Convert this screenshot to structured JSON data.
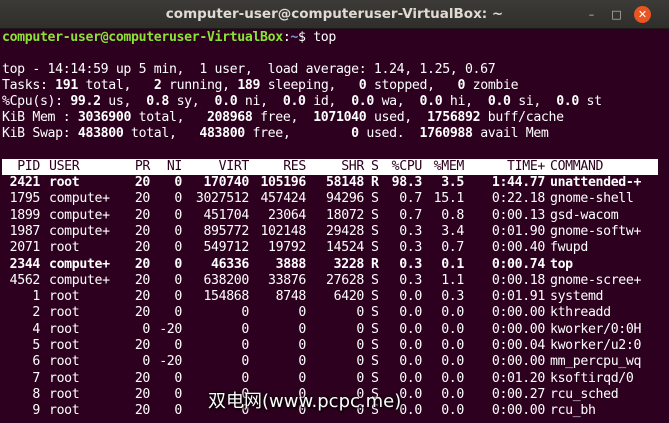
{
  "window": {
    "title": "computer-user@computeruser-VirtualBox: ~"
  },
  "prompt": {
    "user_host": "computer-user@computeruser-VirtualBox",
    "sep": ":",
    "path": "~",
    "symbol": "$ ",
    "command": "top"
  },
  "summary": {
    "line1": "top - 14:14:59 up 5 min,  1 user,  load average: 1.24, 1.25, 0.67",
    "tasks": {
      "label": "Tasks: ",
      "total": "191",
      "t1": " total,   ",
      "running": "2",
      "t2": " running, ",
      "sleeping": "189",
      "t3": " sleeping,   ",
      "stopped": "0",
      "t4": " stopped,   ",
      "zombie": "0",
      "t5": " zombie"
    },
    "cpu": {
      "label": "%Cpu(s): ",
      "us": "99.2",
      "t1": " us,  ",
      "sy": "0.8",
      "t2": " sy,  ",
      "ni": "0.0",
      "t3": " ni,  ",
      "id": "0.0",
      "t4": " id,  ",
      "wa": "0.0",
      "t5": " wa,  ",
      "hi": "0.0",
      "t6": " hi,  ",
      "si": "0.0",
      "t7": " si,  ",
      "st": "0.0",
      "t8": " st"
    },
    "mem": {
      "label": "KiB Mem : ",
      "total": "3036900",
      "t1": " total,   ",
      "free": "208968",
      "t2": " free,  ",
      "used": "1071040",
      "t3": " used,  ",
      "buff": "1756892",
      "t4": " buff/cache"
    },
    "swap": {
      "label": "KiB Swap: ",
      "total": "483800",
      "t1": " total,   ",
      "free": "483800",
      "t2": " free,        ",
      "used": "0",
      "t3": " used.  ",
      "avail": "1760988",
      "t4": " avail Mem"
    }
  },
  "columns": [
    "PID",
    "USER",
    "PR",
    "NI",
    "VIRT",
    "RES",
    "SHR",
    "S",
    "%CPU",
    "%MEM",
    "TIME+",
    "COMMAND"
  ],
  "processes": [
    {
      "pid": "2421",
      "user": "root",
      "pr": "20",
      "ni": "0",
      "virt": "170740",
      "res": "105196",
      "shr": "58148",
      "s": "R",
      "cpu": "98.3",
      "mem": "3.5",
      "time": "1:44.77",
      "command": "unattended-+",
      "bold": true
    },
    {
      "pid": "1795",
      "user": "compute+",
      "pr": "20",
      "ni": "0",
      "virt": "3027512",
      "res": "457424",
      "shr": "94296",
      "s": "S",
      "cpu": "0.7",
      "mem": "15.1",
      "time": "0:22.18",
      "command": "gnome-shell",
      "bold": false
    },
    {
      "pid": "1899",
      "user": "compute+",
      "pr": "20",
      "ni": "0",
      "virt": "451704",
      "res": "23064",
      "shr": "18072",
      "s": "S",
      "cpu": "0.7",
      "mem": "0.8",
      "time": "0:00.13",
      "command": "gsd-wacom",
      "bold": false
    },
    {
      "pid": "1987",
      "user": "compute+",
      "pr": "20",
      "ni": "0",
      "virt": "895772",
      "res": "102148",
      "shr": "29428",
      "s": "S",
      "cpu": "0.3",
      "mem": "3.4",
      "time": "0:01.90",
      "command": "gnome-softw+",
      "bold": false
    },
    {
      "pid": "2071",
      "user": "root",
      "pr": "20",
      "ni": "0",
      "virt": "549712",
      "res": "19792",
      "shr": "14524",
      "s": "S",
      "cpu": "0.3",
      "mem": "0.7",
      "time": "0:00.40",
      "command": "fwupd",
      "bold": false
    },
    {
      "pid": "2344",
      "user": "compute+",
      "pr": "20",
      "ni": "0",
      "virt": "46336",
      "res": "3888",
      "shr": "3228",
      "s": "R",
      "cpu": "0.3",
      "mem": "0.1",
      "time": "0:00.74",
      "command": "top",
      "bold": true
    },
    {
      "pid": "4562",
      "user": "compute+",
      "pr": "20",
      "ni": "0",
      "virt": "638200",
      "res": "33876",
      "shr": "27628",
      "s": "S",
      "cpu": "0.3",
      "mem": "1.1",
      "time": "0:00.18",
      "command": "gnome-scree+",
      "bold": false
    },
    {
      "pid": "1",
      "user": "root",
      "pr": "20",
      "ni": "0",
      "virt": "154868",
      "res": "8748",
      "shr": "6420",
      "s": "S",
      "cpu": "0.0",
      "mem": "0.3",
      "time": "0:01.91",
      "command": "systemd",
      "bold": false
    },
    {
      "pid": "2",
      "user": "root",
      "pr": "20",
      "ni": "0",
      "virt": "0",
      "res": "0",
      "shr": "0",
      "s": "S",
      "cpu": "0.0",
      "mem": "0.0",
      "time": "0:00.00",
      "command": "kthreadd",
      "bold": false
    },
    {
      "pid": "4",
      "user": "root",
      "pr": "0",
      "ni": "-20",
      "virt": "0",
      "res": "0",
      "shr": "0",
      "s": "S",
      "cpu": "0.0",
      "mem": "0.0",
      "time": "0:00.00",
      "command": "kworker/0:0H",
      "bold": false
    },
    {
      "pid": "5",
      "user": "root",
      "pr": "20",
      "ni": "0",
      "virt": "0",
      "res": "0",
      "shr": "0",
      "s": "S",
      "cpu": "0.0",
      "mem": "0.0",
      "time": "0:00.04",
      "command": "kworker/u2:0",
      "bold": false
    },
    {
      "pid": "6",
      "user": "root",
      "pr": "0",
      "ni": "-20",
      "virt": "0",
      "res": "0",
      "shr": "0",
      "s": "S",
      "cpu": "0.0",
      "mem": "0.0",
      "time": "0:00.00",
      "command": "mm_percpu_wq",
      "bold": false
    },
    {
      "pid": "7",
      "user": "root",
      "pr": "20",
      "ni": "0",
      "virt": "0",
      "res": "0",
      "shr": "0",
      "s": "S",
      "cpu": "0.0",
      "mem": "0.0",
      "time": "0:01.20",
      "command": "ksoftirqd/0",
      "bold": false
    },
    {
      "pid": "8",
      "user": "root",
      "pr": "20",
      "ni": "0",
      "virt": "0",
      "res": "0",
      "shr": "0",
      "s": "S",
      "cpu": "0.0",
      "mem": "0.0",
      "time": "0:00.27",
      "command": "rcu_sched",
      "bold": false
    },
    {
      "pid": "9",
      "user": "root",
      "pr": "20",
      "ni": "0",
      "virt": "0",
      "res": "0",
      "shr": "0",
      "s": "S",
      "cpu": "0.0",
      "mem": "0.0",
      "time": "0:00.00",
      "command": "rcu_bh",
      "bold": false
    }
  ],
  "watermark": "双电网(www.pcpc.me)"
}
